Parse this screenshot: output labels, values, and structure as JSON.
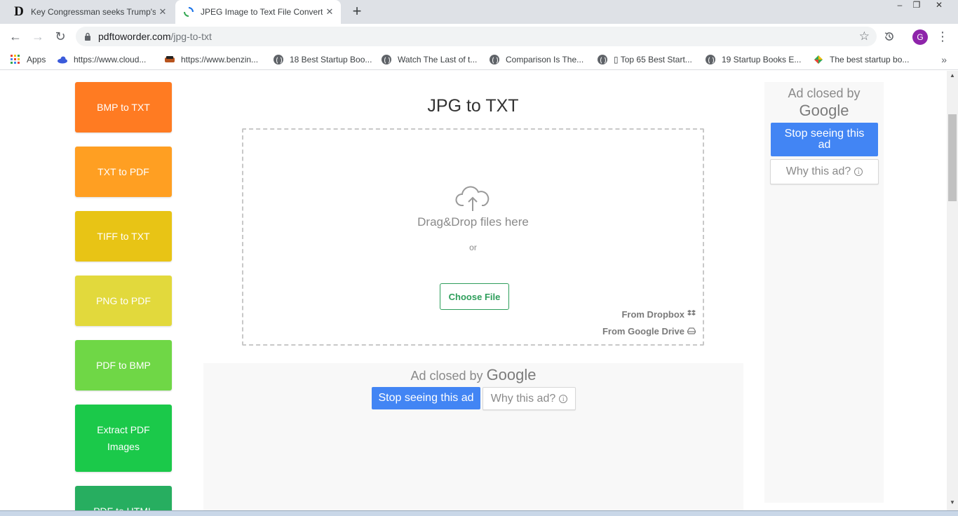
{
  "browser": {
    "tabs": [
      {
        "title": "Key Congressman seeks Trump's",
        "favicon": "letter-d-icon"
      },
      {
        "title": "JPEG Image to Text File Converte",
        "favicon": "loading-icon"
      }
    ],
    "url_host": "pdftoworder.com",
    "url_path": "/jpg-to-txt",
    "profile_initial": "G",
    "bookmarks": [
      {
        "label": "Apps",
        "icon": "apps-grid-icon"
      },
      {
        "label": "https://www.cloud...",
        "icon": "cloud-icon"
      },
      {
        "label": "https://www.benzin...",
        "icon": "car-icon"
      },
      {
        "label": "18 Best Startup Boo...",
        "icon": "globe-icon"
      },
      {
        "label": "Watch The Last of t...",
        "icon": "globe-icon"
      },
      {
        "label": "Comparison Is The...",
        "icon": "globe-icon"
      },
      {
        "label": "▯ Top 65 Best Start...",
        "icon": "globe-icon"
      },
      {
        "label": "19 Startup Books E...",
        "icon": "globe-icon"
      },
      {
        "label": "The best startup bo...",
        "icon": "diamond-icon"
      }
    ]
  },
  "sidebar": {
    "items": [
      {
        "label": "BMP to TXT",
        "color": "#ff7b22"
      },
      {
        "label": "TXT to PDF",
        "color": "#ff9f22"
      },
      {
        "label": "TIFF to TXT",
        "color": "#e8c415"
      },
      {
        "label": "PNG to PDF",
        "color": "#e2d93c"
      },
      {
        "label": "PDF to BMP",
        "color": "#6fd746"
      },
      {
        "label": "Extract PDF Images",
        "color": "#1bc94a"
      },
      {
        "label": "PDF to HTML",
        "color": "#27ae60"
      }
    ]
  },
  "main": {
    "title": "JPG to TXT",
    "drop_text": "Drag&Drop files here",
    "or_text": "or",
    "choose_file": "Choose File",
    "from_dropbox": "From Dropbox",
    "from_gdrive": "From Google Drive"
  },
  "ads": {
    "closed_by": "Ad closed by",
    "google": "Google",
    "stop_seeing": "Stop seeing this ad",
    "why": "Why this ad?"
  }
}
